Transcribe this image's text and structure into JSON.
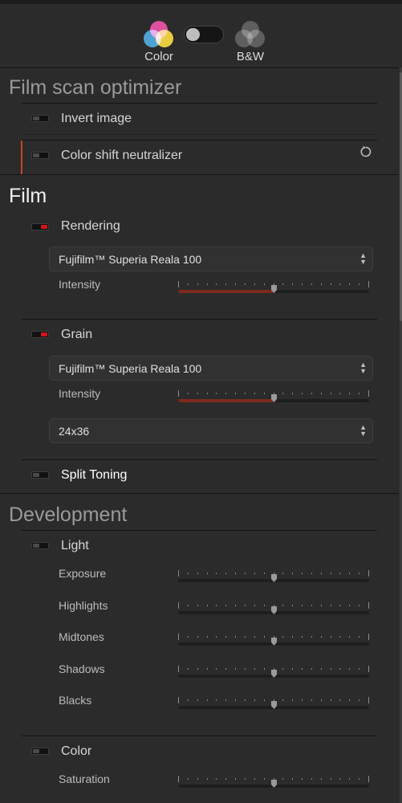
{
  "mode_switch": {
    "color_label": "Color",
    "bw_label": "B&W",
    "selected": "Color"
  },
  "scan_section": {
    "title": "Film scan optimizer",
    "items": [
      {
        "label": "Invert image",
        "enabled": false
      },
      {
        "label": "Color shift neutralizer",
        "enabled": false,
        "reset_icon": "reset-icon"
      }
    ]
  },
  "film_section": {
    "title": "Film",
    "rendering": {
      "label": "Rendering",
      "enabled": true,
      "select_value": "Fujifilm™ Superia Reala 100",
      "intensity_label": "Intensity",
      "intensity": 0.5
    },
    "grain": {
      "label": "Grain",
      "enabled": true,
      "select_value": "Fujifilm™ Superia Reala 100",
      "intensity_label": "Intensity",
      "intensity": 0.5,
      "format_value": "24x36"
    },
    "split_toning": {
      "label": "Split Toning",
      "enabled": false
    }
  },
  "development_section": {
    "title": "Development",
    "light": {
      "label": "Light",
      "enabled": false,
      "params": [
        {
          "label": "Exposure",
          "value": 0.5
        },
        {
          "label": "Highlights",
          "value": 0.5
        },
        {
          "label": "Midtones",
          "value": 0.5
        },
        {
          "label": "Shadows",
          "value": 0.5
        },
        {
          "label": "Blacks",
          "value": 0.5
        }
      ]
    },
    "color": {
      "label": "Color",
      "enabled": false,
      "params": [
        {
          "label": "Saturation",
          "value": 0.5
        }
      ]
    }
  },
  "colors": {
    "accent": "#c2481f",
    "toggle_on": "#d0151b",
    "slider_fill": "#7c2a1c",
    "background": "#2b2b2b"
  }
}
